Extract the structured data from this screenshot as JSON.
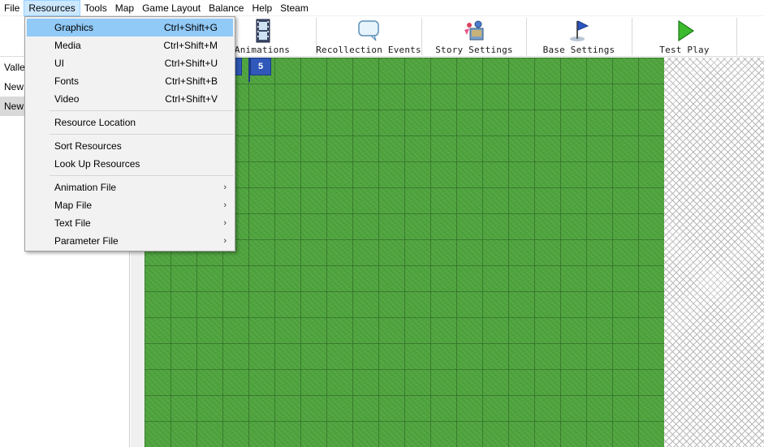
{
  "menubar": {
    "items": [
      "File",
      "Resources",
      "Tools",
      "Map",
      "Game Layout",
      "Balance",
      "Help",
      "Steam"
    ]
  },
  "toolbar": {
    "buttons": [
      {
        "label": "Animations",
        "icon": "film-strip-icon"
      },
      {
        "label": "Recollection Events",
        "icon": "speech-bubble-icon"
      },
      {
        "label": "Story Settings",
        "icon": "story-settings-icon"
      },
      {
        "label": "Base Settings",
        "icon": "blue-flag-icon"
      },
      {
        "label": "Test Play",
        "icon": "play-icon"
      }
    ]
  },
  "left_panel": {
    "rows": [
      "Valle",
      "New",
      "New"
    ],
    "selected_index": 2
  },
  "map": {
    "markers": [
      "",
      "5"
    ],
    "grass_color": "#4ea33d"
  },
  "dropdown": {
    "group1": [
      {
        "label": "Graphics",
        "shortcut": "Ctrl+Shift+G"
      },
      {
        "label": "Media",
        "shortcut": "Ctrl+Shift+M"
      },
      {
        "label": "UI",
        "shortcut": "Ctrl+Shift+U"
      },
      {
        "label": "Fonts",
        "shortcut": "Ctrl+Shift+B"
      },
      {
        "label": "Video",
        "shortcut": "Ctrl+Shift+V"
      }
    ],
    "group2": [
      {
        "label": "Resource Location"
      }
    ],
    "group3": [
      {
        "label": "Sort Resources"
      },
      {
        "label": "Look Up Resources"
      }
    ],
    "group4": [
      {
        "label": "Animation File"
      },
      {
        "label": "Map File"
      },
      {
        "label": "Text File"
      },
      {
        "label": "Parameter File"
      }
    ],
    "submenu_arrow": "›",
    "highlight_color": "#91c9f7"
  }
}
